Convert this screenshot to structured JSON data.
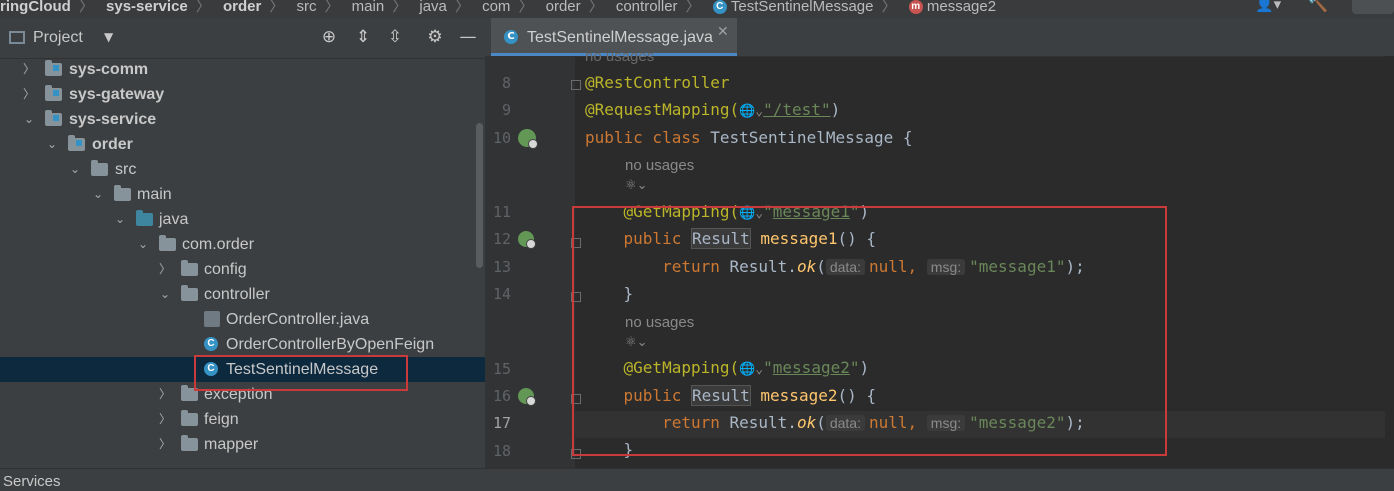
{
  "breadcrumb": [
    {
      "label": "ringCloud",
      "bold": true
    },
    {
      "label": "sys-service",
      "bold": true
    },
    {
      "label": "order",
      "bold": true
    },
    {
      "label": "src"
    },
    {
      "label": "main"
    },
    {
      "label": "java"
    },
    {
      "label": "com"
    },
    {
      "label": "order"
    },
    {
      "label": "controller"
    },
    {
      "label": "TestSentinelMessage",
      "icon": "class-icon"
    },
    {
      "label": "message2",
      "icon": "method-icon"
    }
  ],
  "project": {
    "title": "Project",
    "tree": [
      {
        "label": "sys-comm",
        "bold": true
      },
      {
        "label": "sys-gateway",
        "bold": true
      },
      {
        "label": "sys-service",
        "bold": true
      },
      {
        "label": "order",
        "bold": true
      },
      {
        "label": "src"
      },
      {
        "label": "main"
      },
      {
        "label": "java"
      },
      {
        "label": "com.order"
      },
      {
        "label": "config"
      },
      {
        "label": "controller"
      },
      {
        "label": "OrderController.java"
      },
      {
        "label": "OrderControllerByOpenFeign"
      },
      {
        "label": "TestSentinelMessage"
      },
      {
        "label": "exception"
      },
      {
        "label": "feign"
      },
      {
        "label": "mapper"
      }
    ]
  },
  "editor": {
    "tab_label": "TestSentinelMessage.java",
    "no_usages": "no usages",
    "line_numbers": [
      "8",
      "9",
      "10",
      "11",
      "12",
      "13",
      "14",
      "15",
      "16",
      "17",
      "18"
    ],
    "code": {
      "rest_controller": "@RestController",
      "request_mapping": "@RequestMapping(",
      "request_path": "\"/test\"",
      "class_kw": "public class ",
      "class_name": "TestSentinelMessage {",
      "get_mapping": "@GetMapping(",
      "path1": "message1",
      "path2": "message2",
      "public_kw": "public ",
      "result_type": "Result",
      "method1": "message1",
      "method2": "message2",
      "paren_open": "() {",
      "return_kw": "return ",
      "result_call": "Result.",
      "ok_fn": "ok",
      "hint_data": "data:",
      "hint_msg": "msg:",
      "null_kw": "null,",
      "msg1": "\"message1\"",
      "msg2": "\"message2\"",
      "close_brace": "}"
    }
  },
  "status": {
    "services_label": "Services"
  },
  "colors": {
    "annotation": "#bbb529",
    "keyword": "#cc7832",
    "string": "#6a8759",
    "method": "#ffc66d",
    "highlight_box": "#c93b3b"
  }
}
